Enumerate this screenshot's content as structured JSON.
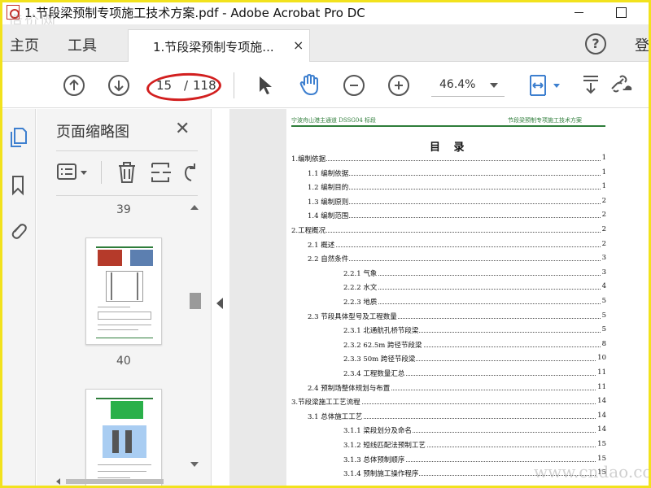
{
  "window": {
    "title": "1.节段梁预制专项施工技术方案.pdf - Adobe Acrobat Pro DC"
  },
  "watermarks": {
    "top_left": "造价网",
    "bottom_right": "www.cndao.com"
  },
  "tabbar": {
    "home_label": "主页",
    "tools_label": "工具",
    "doc_tab_label": "1.节段梁预制专项施...",
    "close_glyph": "×",
    "help_glyph": "?",
    "signin_label": "登"
  },
  "toolbar": {
    "page_current": "15",
    "page_separator": "/",
    "page_total": "118",
    "zoom_value": "46.4%",
    "highlight_color": "#d21f1f"
  },
  "panel": {
    "title": "页面缩略图",
    "close_glyph": "✕",
    "thumbs": [
      {
        "label": "39"
      },
      {
        "label": "40"
      }
    ]
  },
  "document": {
    "header_left": "宁波舟山港主通道 DSSG04 标段",
    "header_right": "节段梁预制专项施工技术方案",
    "toc_title": "目 录",
    "header_color": "#2e7d3a",
    "toc": [
      {
        "text": "1.编制依据",
        "page": "1",
        "indent": 0
      },
      {
        "text": "1.1 编制依据",
        "page": "1",
        "indent": 1
      },
      {
        "text": "1.2 编制目的",
        "page": "1",
        "indent": 1
      },
      {
        "text": "1.3 编制原则",
        "page": "2",
        "indent": 1
      },
      {
        "text": "1.4 编制范围",
        "page": "2",
        "indent": 1
      },
      {
        "text": "2.工程概况",
        "page": "2",
        "indent": 0
      },
      {
        "text": "2.1 概述",
        "page": "2",
        "indent": 1
      },
      {
        "text": "2.2 自然条件",
        "page": "3",
        "indent": 1
      },
      {
        "text": "2.2.1 气象",
        "page": "3",
        "indent": 2
      },
      {
        "text": "2.2.2 水文",
        "page": "4",
        "indent": 2
      },
      {
        "text": "2.2.3 地质",
        "page": "5",
        "indent": 2
      },
      {
        "text": "2.3 节段具体型号及工程数量",
        "page": "5",
        "indent": 1
      },
      {
        "text": "2.3.1 北通航孔桥节段梁",
        "page": "5",
        "indent": 2
      },
      {
        "text": "2.3.2 62.5m 跨径节段梁",
        "page": "8",
        "indent": 2
      },
      {
        "text": "2.3.3 50m 跨径节段梁",
        "page": "10",
        "indent": 2
      },
      {
        "text": "2.3.4 工程数量汇总",
        "page": "11",
        "indent": 2
      },
      {
        "text": "2.4 预制场整体规划与布置",
        "page": "11",
        "indent": 1
      },
      {
        "text": "3.节段梁施工工艺流程",
        "page": "14",
        "indent": 0
      },
      {
        "text": "3.1 总体施工工艺",
        "page": "14",
        "indent": 1
      },
      {
        "text": "3.1.1 梁段划分及命名",
        "page": "14",
        "indent": 2
      },
      {
        "text": "3.1.2 短线匹配法预制工艺",
        "page": "15",
        "indent": 2
      },
      {
        "text": "3.1.3 总体预制顺序",
        "page": "15",
        "indent": 2
      },
      {
        "text": "3.1.4 预制施工操作程序",
        "page": "15",
        "indent": 2
      }
    ]
  }
}
